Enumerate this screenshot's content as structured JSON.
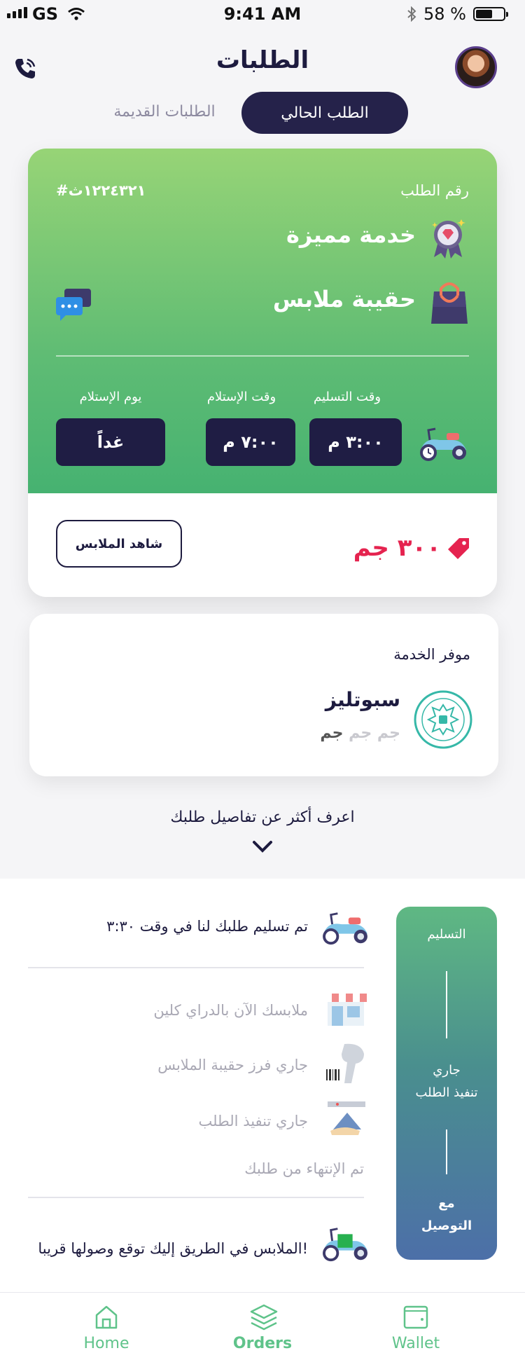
{
  "status_bar": {
    "carrier": "GS",
    "time": "9:41 AM",
    "battery": "58 %"
  },
  "header": {
    "title": "الطلبات"
  },
  "tabs": {
    "current": "الطلب الحالي",
    "old": "الطلبات القديمة"
  },
  "order": {
    "number_label": "رقم الطلب",
    "number": "#١٢٢٤٣٢١ث",
    "service_type": "خدمة مميزة",
    "bag_type": "حقيبة ملابس",
    "delivery_time_label": "وقت التسليم",
    "delivery_time": "٣:٠٠ م",
    "pickup_time_label": "وقت الإستلام",
    "pickup_time": "٧:٠٠ م",
    "pickup_day_label": "يوم الإستلام",
    "pickup_day": "غداً",
    "price": "٣٠٠ جم",
    "view_clothes": "شاهد الملابس"
  },
  "provider": {
    "label": "موفر الخدمة",
    "name": "سبوتليز",
    "price_level_on": "جم",
    "price_level_off": "جم جم"
  },
  "more_details": "اعرف أكثر عن تفاصيل طلبك",
  "tracking": {
    "steps": [
      {
        "text": "تم تسليم طلبك لنا في وقت ٣:٣٠",
        "state": "done"
      },
      {
        "text": "ملابسك الآن بالدراي كلين",
        "state": "pending"
      },
      {
        "text": "جاري فرز حقيبة الملابس",
        "state": "pending"
      },
      {
        "text": "جاري تنفيذ الطلب",
        "state": "pending"
      },
      {
        "text": "تم الإنتهاء من طلبك",
        "state": "pending"
      },
      {
        "text": "الملابس في الطريق إليك توقع وصولها قريبا!",
        "state": "done"
      }
    ],
    "timeline": {
      "top": "التسليم",
      "middle_1": "جاري",
      "middle_2": "تنفيذ الطلب",
      "bottom_1": "مع",
      "bottom_2": "التوصيل"
    }
  },
  "tabbar": {
    "home": "Home",
    "orders": "Orders",
    "wallet": "Wallet",
    "accent": "#5fc38a"
  },
  "colors": {
    "navy": "#1d1b3f",
    "price_red": "#e5234f",
    "green_top": "#97d476",
    "green_bottom": "#46b271"
  }
}
